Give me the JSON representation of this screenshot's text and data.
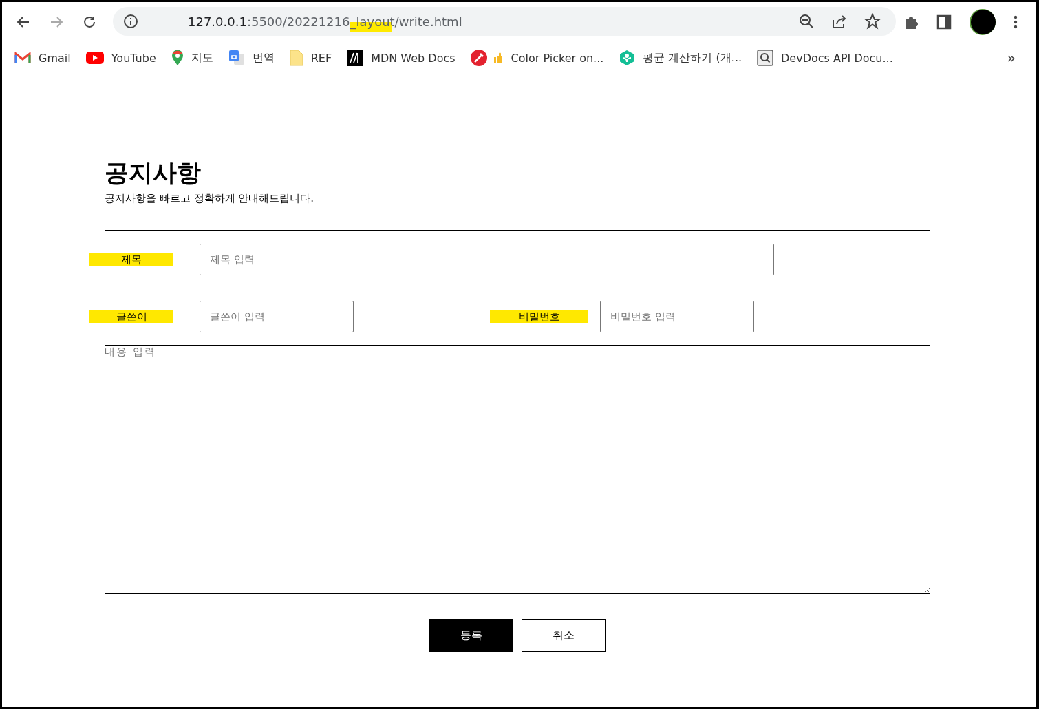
{
  "browser": {
    "url_host": "127.0.0.1",
    "url_path": ":5500/20221216_layout/write.html",
    "url_highlighted": true,
    "bookmarks": [
      {
        "label": "Gmail"
      },
      {
        "label": "YouTube"
      },
      {
        "label": "지도"
      },
      {
        "label": "번역"
      },
      {
        "label": "REF"
      },
      {
        "label": "MDN Web Docs"
      },
      {
        "label": "Color Picker on..."
      },
      {
        "label": "평균 계산하기 (개..."
      },
      {
        "label": "DevDocs API Docu..."
      }
    ],
    "overflow": "»"
  },
  "page": {
    "title": "공지사항",
    "subtitle": "공지사항을 빠르고 정확하게 안내해드립니다.",
    "rows": [
      [
        {
          "label": "제목",
          "placeholder": "제목 입력",
          "highlighted": true,
          "kind": "wide"
        }
      ],
      [
        {
          "label": "글쓴이",
          "placeholder": "글쓴이 입력",
          "highlighted": true,
          "kind": "short"
        },
        {
          "label": "비밀번호",
          "placeholder": "비밀번호 입력",
          "highlighted": true,
          "kind": "password"
        }
      ]
    ],
    "content": {
      "placeholder": "내용 입력"
    },
    "buttons": [
      {
        "label": "등록",
        "kind": "primary"
      },
      {
        "label": "취소",
        "kind": "secondary"
      }
    ]
  }
}
